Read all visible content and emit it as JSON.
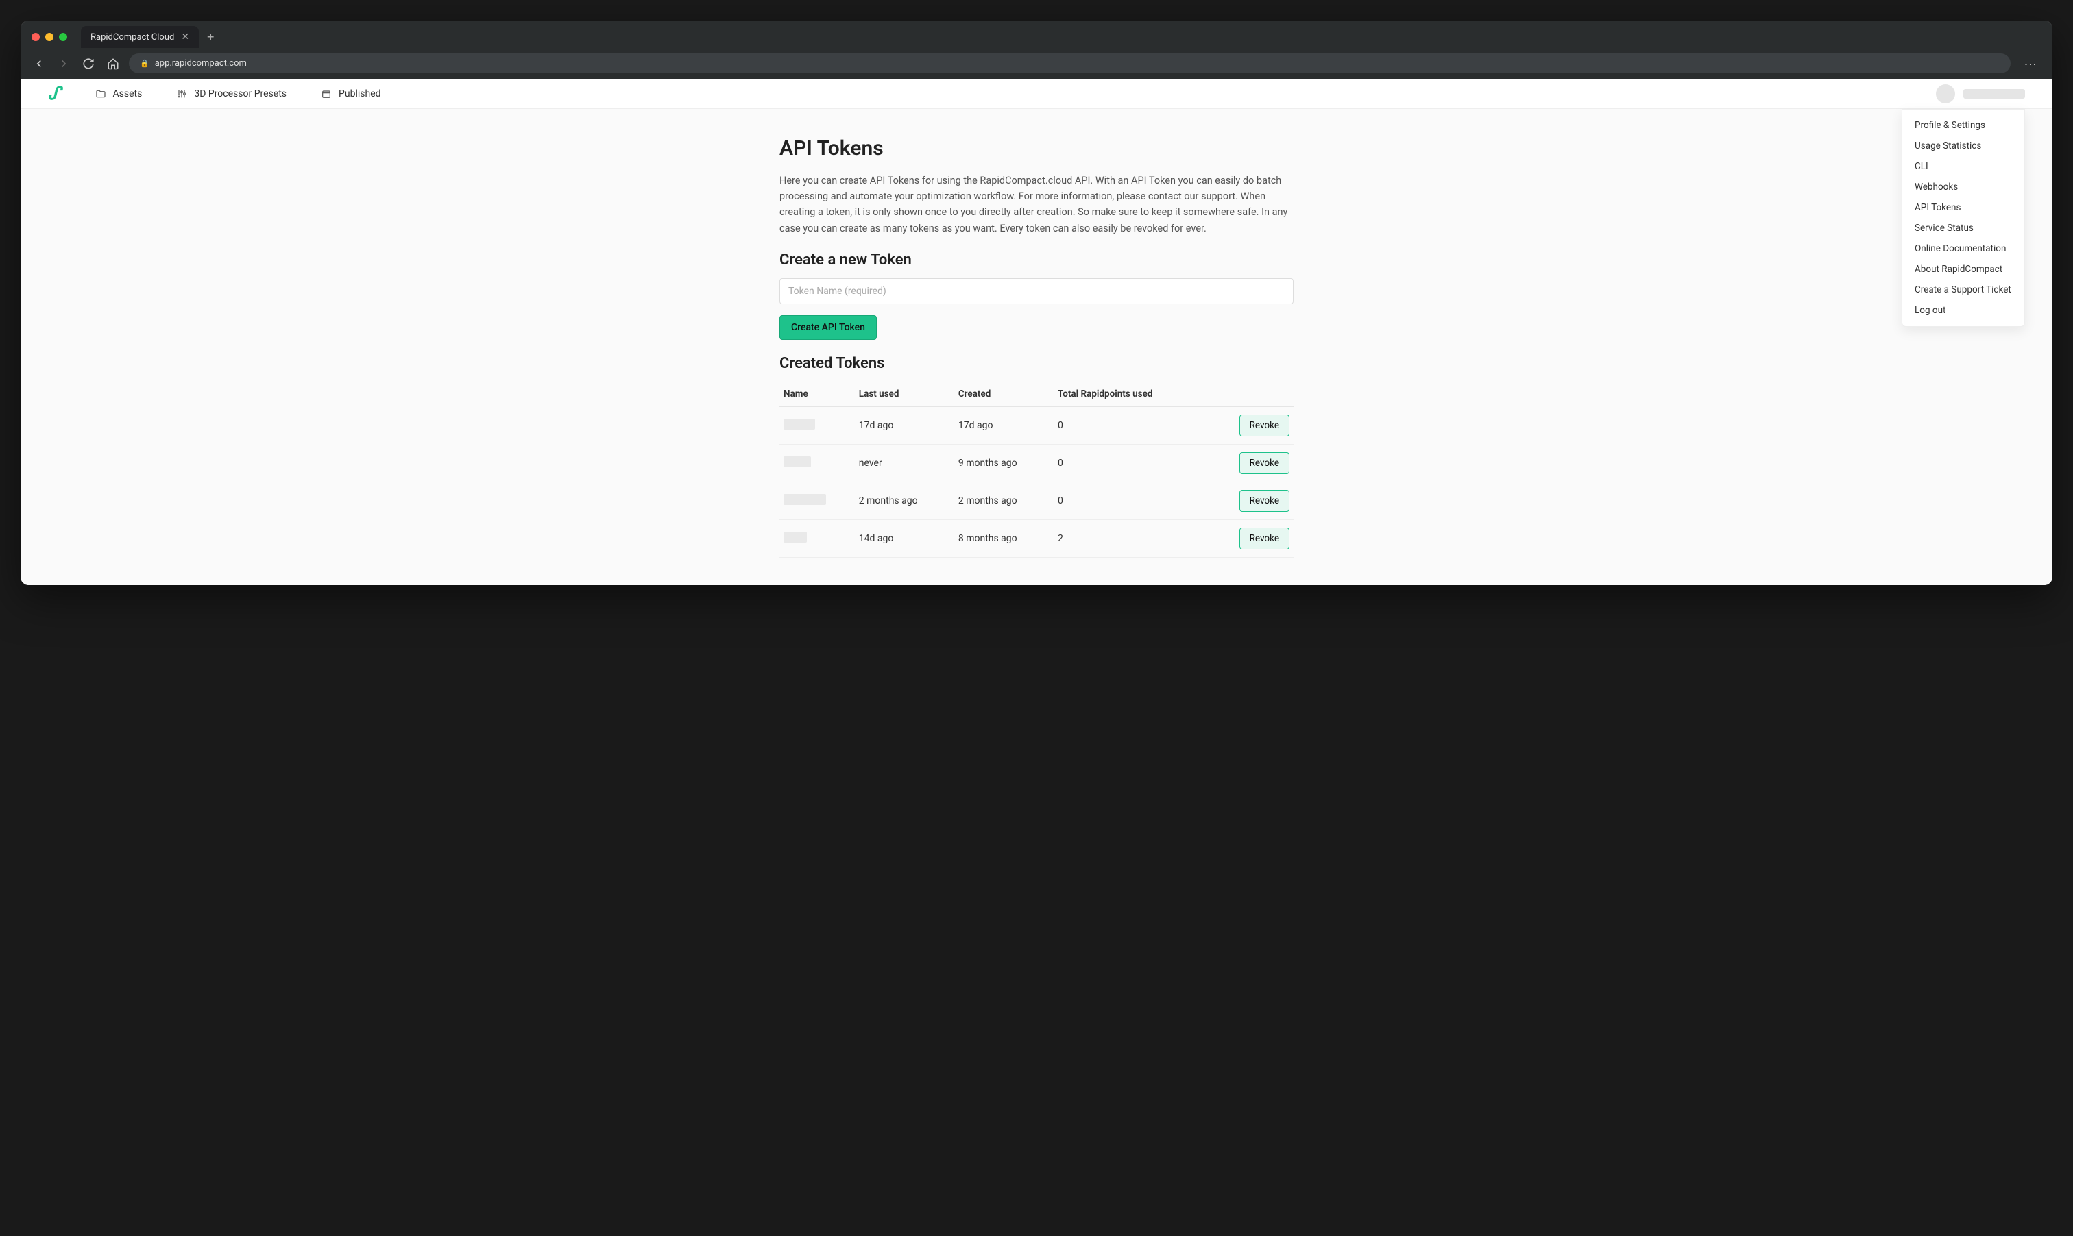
{
  "browser": {
    "tab_title": "RapidCompact Cloud",
    "url": "app.rapidcompact.com"
  },
  "nav": {
    "assets": "Assets",
    "presets": "3D Processor Presets",
    "published": "Published"
  },
  "dropdown": {
    "items": [
      "Profile & Settings",
      "Usage Statistics",
      "CLI",
      "Webhooks",
      "API Tokens",
      "Service Status",
      "Online Documentation",
      "About RapidCompact",
      "Create a Support Ticket",
      "Log out"
    ]
  },
  "page": {
    "title": "API Tokens",
    "description": "Here you can create API Tokens for using the RapidCompact.cloud API. With an API Token you can easily do batch processing and automate your optimization workflow. For more information, please contact our support. When creating a token, it is only shown once to you directly after creation. So make sure to keep it somewhere safe. In any case you can create as many tokens as you want. Every token can also easily be revoked for ever.",
    "create_heading": "Create a new Token",
    "token_placeholder": "Token Name (required)",
    "create_button": "Create API Token",
    "list_heading": "Created Tokens"
  },
  "table": {
    "headers": {
      "name": "Name",
      "last_used": "Last used",
      "created": "Created",
      "points": "Total Rapidpoints used"
    },
    "revoke_label": "Revoke",
    "rows": [
      {
        "last_used": "17d ago",
        "created": "17d ago",
        "points": "0",
        "name_w": 46
      },
      {
        "last_used": "never",
        "created": "9 months ago",
        "points": "0",
        "name_w": 40
      },
      {
        "last_used": "2 months ago",
        "created": "2 months ago",
        "points": "0",
        "name_w": 62
      },
      {
        "last_used": "14d ago",
        "created": "8 months ago",
        "points": "2",
        "name_w": 34
      }
    ]
  }
}
